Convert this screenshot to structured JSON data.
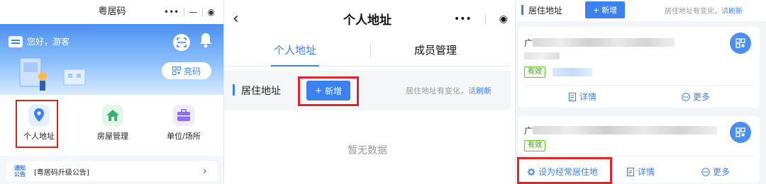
{
  "mini_program": {
    "title": "粤居码",
    "capsule": {
      "more": "•••",
      "minimize": "—",
      "close": "◉"
    },
    "greeting": "您好，游客",
    "code_button": "亮码",
    "services": [
      {
        "label": "个人地址",
        "icon": "location-pin-icon",
        "color": "#3c82ee"
      },
      {
        "label": "房屋管理",
        "icon": "house-icon",
        "color": "#38b56a"
      },
      {
        "label": "单位/场所",
        "icon": "briefcase-icon",
        "color": "#8a6df0"
      }
    ],
    "notice": {
      "tag_line1": "通知",
      "tag_line2": "公告",
      "text": "[粤居码升级公告]",
      "arrow": "›"
    }
  },
  "address_page": {
    "back": "‹",
    "title": "个人地址",
    "capsule": {
      "more": "•••",
      "close": "◉"
    },
    "tabs": [
      {
        "label": "个人地址",
        "active": true
      },
      {
        "label": "成员管理",
        "active": false
      }
    ],
    "section_title": "居住地址",
    "add_button": "新增",
    "add_icon": "+",
    "hint_text": "居住地址有变化，请",
    "refresh_link": "刷新",
    "empty_text": "暂无数据"
  },
  "address_list": {
    "section_title": "居住地址",
    "add_button": "新增",
    "add_icon": "+",
    "hint_text": "居住地址有变化，请",
    "refresh_link": "刷新",
    "cards": [
      {
        "addr_prefix": "广",
        "status": "有效",
        "actions": [
          "详情",
          "更多"
        ]
      },
      {
        "addr_prefix": "广",
        "status": "有效",
        "actions": [
          "设为经常居住地",
          "详情",
          "更多"
        ]
      }
    ]
  },
  "colors": {
    "primary": "#3c82ee",
    "highlight": "#e0262b",
    "valid": "#67c23a"
  }
}
